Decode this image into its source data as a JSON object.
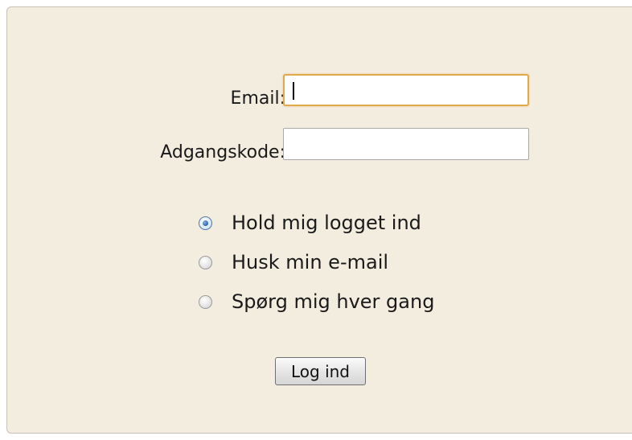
{
  "form": {
    "email_label": "Email:",
    "email_value": "",
    "password_label": "Adgangskode:",
    "password_value": ""
  },
  "remember_options": [
    {
      "label": "Hold mig logget ind",
      "selected": true
    },
    {
      "label": "Husk min e-mail",
      "selected": false
    },
    {
      "label": "Spørg mig hver gang",
      "selected": false
    }
  ],
  "submit_label": "Log ind",
  "colors": {
    "panel_background": "#f3ede0",
    "focus_border": "#e0a94a",
    "radio_selected": "#1f5aa0"
  }
}
